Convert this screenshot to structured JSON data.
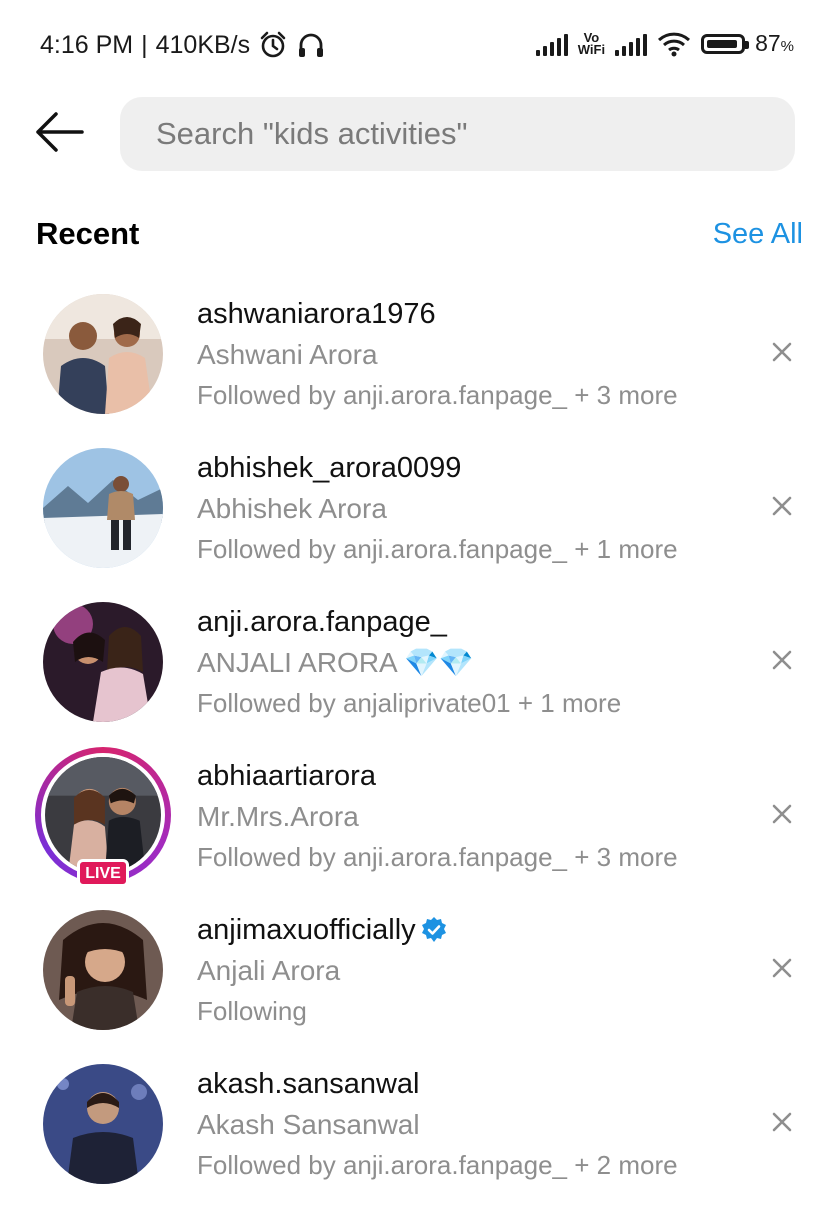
{
  "status_bar": {
    "time": "4:16 PM",
    "separator": "|",
    "speed": "410KB/s",
    "vowifi_top": "Vo",
    "vowifi_bottom": "WiFi",
    "battery_percent": "87",
    "battery_percent_sign": "%",
    "icons": [
      "alarm-icon",
      "headphones-icon",
      "signal-icon",
      "wifi-icon",
      "battery-icon"
    ]
  },
  "search": {
    "placeholder": "Search \"kids activities\"",
    "value": ""
  },
  "recent": {
    "title": "Recent",
    "see_all": "See All"
  },
  "accent_color": "#1d92e2",
  "items": [
    {
      "username": "ashwaniarora1976",
      "name": "Ashwani Arora",
      "followed": "Followed by anji.arora.fanpage_ + 3 more"
    },
    {
      "username": "abhishek_arora0099",
      "name": "Abhishek Arora",
      "followed": "Followed by anji.arora.fanpage_ + 1 more"
    },
    {
      "username": "anji.arora.fanpage_",
      "name": "ANJALI ARORA 💎💎",
      "followed": "Followed by anjaliprivate01 + 1 more"
    },
    {
      "username": "abhiaartiarora",
      "name": "Mr.Mrs.Arora",
      "followed": "Followed by anji.arora.fanpage_ + 3 more",
      "live_label": "LIVE"
    },
    {
      "username": "anjimaxuofficially",
      "name": "Anjali Arora",
      "followed": "Following",
      "verified": true
    },
    {
      "username": "akash.sansanwal",
      "name": "Akash Sansanwal",
      "followed": "Followed by anji.arora.fanpage_ + 2 more"
    }
  ]
}
